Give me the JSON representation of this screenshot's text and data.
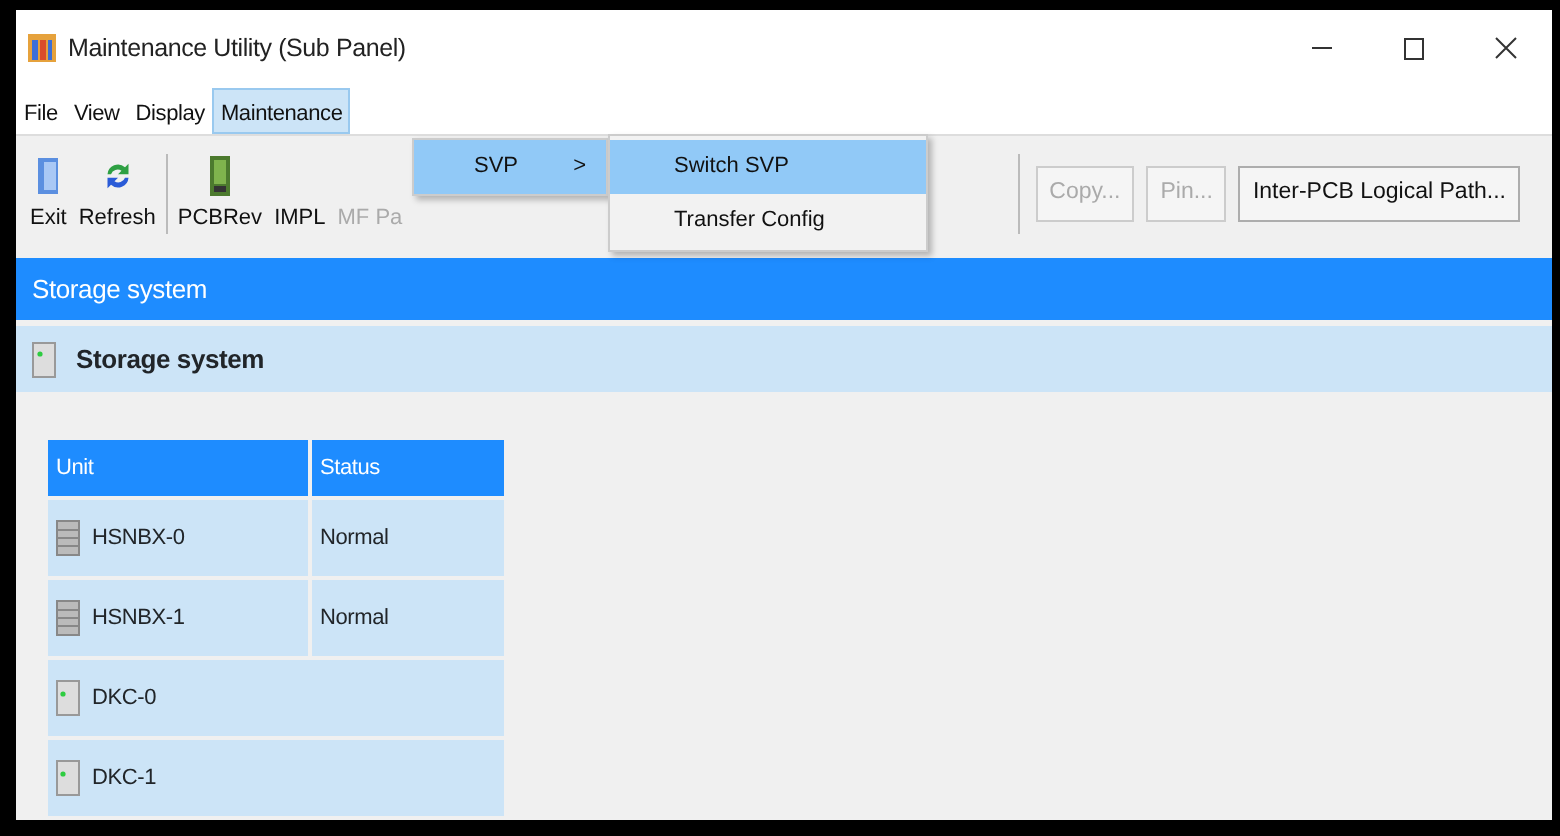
{
  "window": {
    "title": "Maintenance Utility (Sub Panel)"
  },
  "menu_bar": [
    {
      "label": "File",
      "selected": false
    },
    {
      "label": "View",
      "selected": false
    },
    {
      "label": "Display",
      "selected": false
    },
    {
      "label": "Maintenance",
      "selected": true
    }
  ],
  "open_menu": {
    "items": [
      {
        "label": "SVP",
        "arrow": ">",
        "selected": true
      }
    ]
  },
  "submenu": {
    "items": [
      {
        "label": "Switch SVP",
        "selected": true
      },
      {
        "label": "Transfer Config",
        "selected": false
      }
    ]
  },
  "toolbar": {
    "tool_groups": [
      [
        {
          "label": "Exit",
          "kind": "exit",
          "disabled": false
        },
        {
          "label": "Refresh",
          "kind": "refresh",
          "disabled": false
        }
      ],
      [
        {
          "label": "PCBRev",
          "kind": "board",
          "disabled": false
        },
        {
          "label": "IMPL",
          "kind": "covered",
          "disabled": false
        },
        {
          "label": "MF Pa",
          "kind": "covered",
          "disabled": true
        }
      ]
    ],
    "buttons": [
      {
        "label": "Copy...",
        "disabled": true
      },
      {
        "label": "Pin...",
        "disabled": true
      },
      {
        "label": "Inter-PCB Logical Path...",
        "disabled": false
      }
    ]
  },
  "header": {
    "title": "Storage system"
  },
  "subheader": {
    "title": "Storage system"
  },
  "table": {
    "columns": [
      "Unit",
      "Status"
    ],
    "rows": [
      {
        "unit": "HSNBX-0",
        "kind": "drive-bay",
        "status": "Normal"
      },
      {
        "unit": "HSNBX-1",
        "kind": "drive-bay",
        "status": "Normal"
      },
      {
        "unit": "DKC-0",
        "kind": "controller"
      },
      {
        "unit": "DKC-1",
        "kind": "controller"
      }
    ]
  }
}
